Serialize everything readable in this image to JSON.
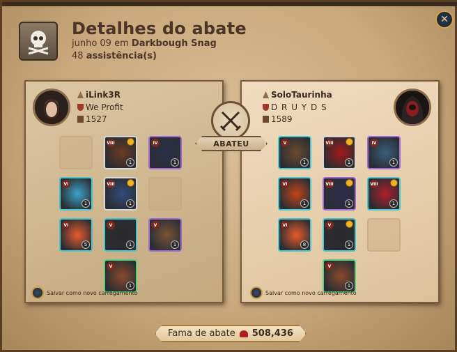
{
  "header": {
    "title": "Detalhes do abate",
    "date_prefix": "junho 09 em",
    "location": "Darkbough Snag",
    "assist_count": "48",
    "assist_label": "assistência(s)"
  },
  "killer": {
    "name": "iLink3R",
    "guild": "We Profit",
    "item_power": "1527",
    "save_label": "Salvar como novo carregamento",
    "slots": [
      {
        "id": "bag",
        "empty": true
      },
      {
        "id": "head",
        "tier": "VIII",
        "qty": "1",
        "border": "#d8d8d8",
        "color": "#6b3a22",
        "star": true
      },
      {
        "id": "cape",
        "tier": "IV",
        "qty": "1",
        "border": "#a26ad9",
        "color": "#2a2f4a",
        "star": false
      },
      {
        "id": "mainhand",
        "tier": "VI",
        "qty": "1",
        "border": "#45c8d0",
        "color": "#3aa3c7",
        "star": false
      },
      {
        "id": "armor",
        "tier": "VIII",
        "qty": "1",
        "border": "#d8d8d8",
        "color": "#314b7a",
        "star": true
      },
      {
        "id": "offhand",
        "empty": true
      },
      {
        "id": "potion",
        "tier": "VI",
        "qty": "5",
        "border": "#45c8d0",
        "color": "#e85a2a",
        "star": false
      },
      {
        "id": "shoes",
        "tier": "V",
        "qty": "1",
        "border": "#45c8d0",
        "color": "#2b2a2a",
        "star": false
      },
      {
        "id": "food",
        "tier": "V",
        "qty": "1",
        "border": "#a26ad9",
        "color": "#7a5535",
        "star": false
      },
      {
        "id": "mount",
        "tier": "V",
        "qty": "1",
        "border": "#5bd07a",
        "color": "#8a4a2c",
        "star": false
      }
    ]
  },
  "victim": {
    "name": "SoloTaurinha",
    "guild": "D R U Y D S",
    "item_power": "1589",
    "save_label": "Salvar como novo carregamento",
    "slots": [
      {
        "id": "bag",
        "tier": "V",
        "qty": "1",
        "border": "#45c8d0",
        "color": "#6b4a2c",
        "star": false
      },
      {
        "id": "head",
        "tier": "VIII",
        "qty": "1",
        "border": "#d8d8d8",
        "color": "#a51818",
        "star": true
      },
      {
        "id": "cape",
        "tier": "IV",
        "qty": "1",
        "border": "#a26ad9",
        "color": "#3a5e7a",
        "star": false
      },
      {
        "id": "mainhand",
        "tier": "VI",
        "qty": "1",
        "border": "#45c8d0",
        "color": "#c24418",
        "star": false
      },
      {
        "id": "armor",
        "tier": "VIII",
        "qty": "1",
        "border": "#a26ad9",
        "color": "#2e2c4e",
        "star": true
      },
      {
        "id": "offhand",
        "tier": "VIII",
        "qty": "1",
        "border": "#45c8d0",
        "color": "#b01d2a",
        "star": true
      },
      {
        "id": "potion",
        "tier": "VI",
        "qty": "8",
        "border": "#45c8d0",
        "color": "#e85a2a",
        "star": false
      },
      {
        "id": "shoes",
        "tier": "V",
        "qty": "1",
        "border": "#45c8d0",
        "color": "#2b2a2a",
        "star": true
      },
      {
        "id": "food",
        "empty": true
      },
      {
        "id": "mount",
        "tier": "V",
        "qty": "1",
        "border": "#5bd07a",
        "color": "#8a4a2c",
        "star": false
      }
    ]
  },
  "versus_label": "ABATEU",
  "fame": {
    "label": "Fama de abate",
    "value": "508,436"
  },
  "icons": [
    "skull-icon",
    "close-icon",
    "crossed-swords-icon",
    "save-loadout-icon",
    "fame-icon"
  ]
}
